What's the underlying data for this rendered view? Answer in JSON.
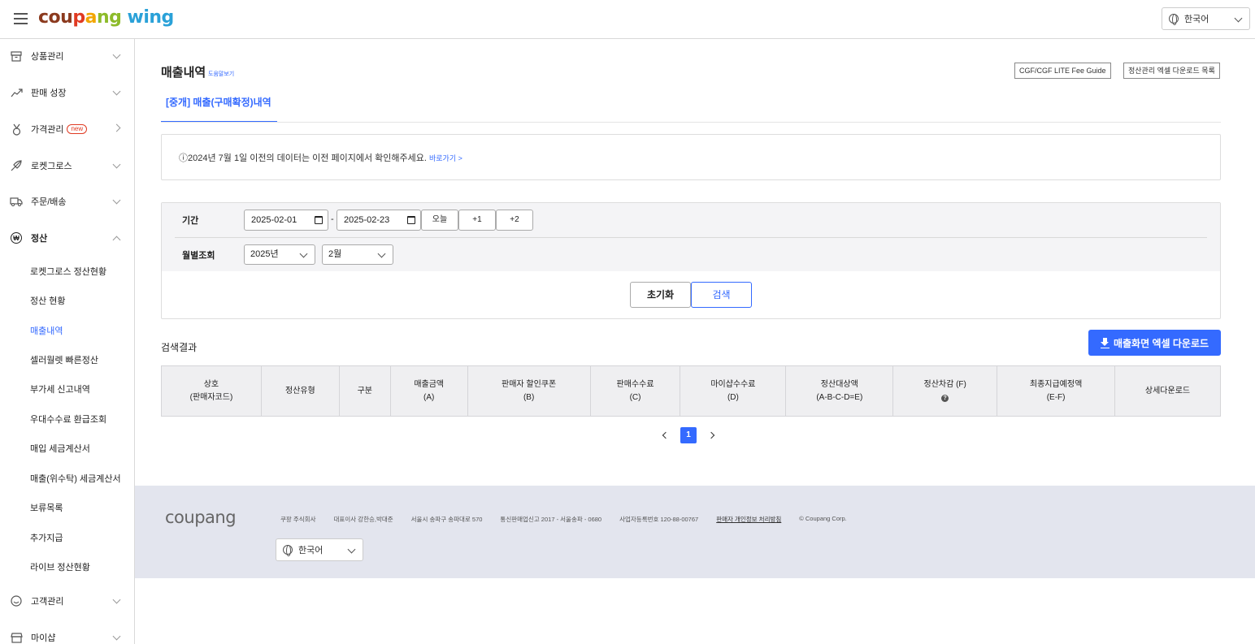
{
  "header": {
    "logo": [
      "cou",
      "p",
      "a",
      "ng",
      " wi",
      "ng"
    ],
    "language": "한국어"
  },
  "sidebar": {
    "items": [
      {
        "label": "상품관리",
        "icon": "box-icon"
      },
      {
        "label": "판매 성장",
        "icon": "trend-up-icon"
      },
      {
        "label": "가격관리",
        "icon": "medal-icon",
        "badge": "new"
      },
      {
        "label": "로켓그로스",
        "icon": "rocket-icon"
      },
      {
        "label": "주문/배송",
        "icon": "truck-icon"
      },
      {
        "label": "정산",
        "icon": "won-icon",
        "icon_text": "₩"
      },
      {
        "label": "고객관리",
        "icon": "smile-icon"
      },
      {
        "label": "마이샵",
        "icon": "shop-icon"
      }
    ],
    "sub_items": [
      "로켓그로스 정산현황",
      "정산 현황",
      "매출내역",
      "셀러월렛 빠른정산",
      "부가세 신고내역",
      "우대수수료 환급조회",
      "매입 세금계산서",
      "매출(위수탁) 세금계산서",
      "보류목록",
      "추가지급",
      "라이브 정산현황"
    ],
    "active_sub": "매출내역"
  },
  "main": {
    "title": "매출내역",
    "help": "도움말보기",
    "guide_buttons": [
      "CGF/CGF LITE Fee Guide",
      "정산관리 엑셀 다운로드 목록"
    ],
    "tab": "[중개] 매출(구매확정)내역",
    "notice": "ⓘ2024년 7월 1일 이전의 데이터는 이전 페이지에서 확인해주세요.",
    "notice_link": "바로가기 >"
  },
  "filter": {
    "period_label": "기간",
    "start_date": "2025-02-01",
    "end_date": "2025-02-23",
    "dash": "-",
    "quick": [
      "오늘",
      "+1",
      "+2"
    ],
    "monthly_label": "월별조회",
    "year": "2025년",
    "month": "2월",
    "reset": "초기화",
    "search": "검색"
  },
  "results": {
    "title": "검색결과",
    "excel_button": "매출화면 엑셀 다운로드",
    "columns": [
      [
        "상호",
        "(판매자코드)"
      ],
      [
        "정산유형"
      ],
      [
        "구분"
      ],
      [
        "매출금액",
        "(A)"
      ],
      [
        "판매자 할인쿠폰",
        "(B)"
      ],
      [
        "판매수수료",
        "(C)"
      ],
      [
        "마이샵수수료",
        "(D)"
      ],
      [
        "정산대상액",
        "(A-B-C-D=E)"
      ],
      [
        "정산차감 (F)",
        "?"
      ],
      [
        "최종지급예정액",
        "(E-F)"
      ],
      [
        "상세다운로드"
      ]
    ],
    "page": "1"
  },
  "footer": {
    "logo": "coupang",
    "info": [
      "쿠팡 주식회사",
      "대표이사 강한승,박대준",
      "서울시 송파구 송파대로 570",
      "통신판매업신고 2017 - 서울송파 - 0680",
      "사업자등록번호 120-88-00767",
      "판매자 개인정보 처리방침",
      "© Coupang Corp."
    ],
    "language": "한국어"
  },
  "colors": {
    "accent": "#346aff",
    "footer_bg": "#e3e5ee",
    "filter_bg": "#f4f4f6"
  }
}
